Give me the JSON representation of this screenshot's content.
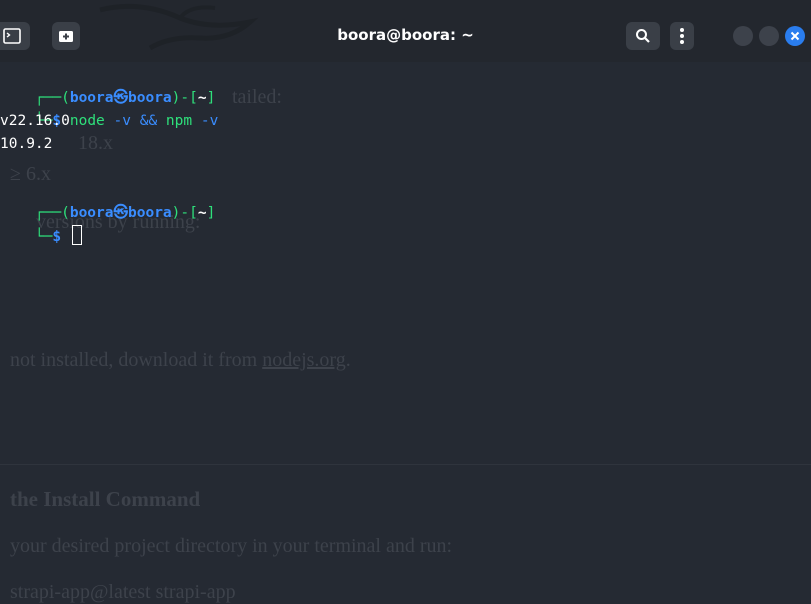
{
  "window": {
    "title": "boora@boora: ~",
    "icons": {
      "terminal": "terminal-icon",
      "new_tab": "new-tab-icon",
      "search": "search-icon",
      "menu": "kebab-menu-icon",
      "minimize": "minimize-icon",
      "maximize": "maximize-icon",
      "close": "close-icon"
    },
    "accent": "#2a7dee"
  },
  "terminal": {
    "prompt1": {
      "box_top": "┌──(",
      "user": "boora",
      "at_symbol": "㉿",
      "host": "boora",
      "mid": ")-[",
      "path": "~",
      "end": "]",
      "box_bottom": "└─",
      "dollar": "$",
      "command": "node",
      "arg1": "-v",
      "op": "&&",
      "command2": "npm",
      "arg2": "-v"
    },
    "output": [
      "v22.16.0",
      "10.9.2"
    ],
    "prompt2": {
      "box_top": "┌──(",
      "user": "boora",
      "at_symbol": "㉿",
      "host": "boora",
      "mid": ")-[",
      "path": "~",
      "end": "]",
      "box_bottom": "└─",
      "dollar": "$"
    }
  },
  "background_page": {
    "line1": "tailed:",
    "line2": "18.x",
    "line3": "≥ 6.x",
    "line4": "versions by running:",
    "line5_pre": "not installed, download it from ",
    "line5_link": "nodejs.org",
    "line5_post": ".",
    "heading": "the Install Command",
    "line6": "your desired project directory in your terminal and run:",
    "line7": "strapi-app@latest strapi-app"
  },
  "colors": {
    "background": "#252a33",
    "titlebar": "#23272e",
    "prompt_blue": "#3a8dff",
    "command_green": "#2ee07b"
  }
}
